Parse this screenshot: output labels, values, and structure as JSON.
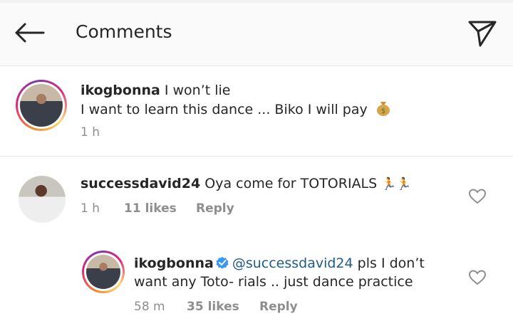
{
  "header": {
    "title": "Comments"
  },
  "comments": [
    {
      "username": "ikogbonna",
      "text_line1": "I won’t lie",
      "text_line2": "I want to learn this dance ... Biko I will pay",
      "emoji": "money-bag",
      "time": "1 h"
    },
    {
      "username": "successdavid24",
      "text": "Oya come for TOTORIALS",
      "emoji": "running-people",
      "time": "1 h",
      "likes": "11 likes",
      "reply": "Reply"
    },
    {
      "username": "ikogbonna",
      "mention": "@successdavid24",
      "text_line1": "pls I don’t",
      "text_line2": "want any Toto- rials .. just dance practice",
      "time": "58 m",
      "likes": "35 likes",
      "reply": "Reply"
    }
  ],
  "colors": {
    "mention": "#1e5a8a",
    "verified": "#3897f0",
    "meta": "#8e8e8e"
  }
}
